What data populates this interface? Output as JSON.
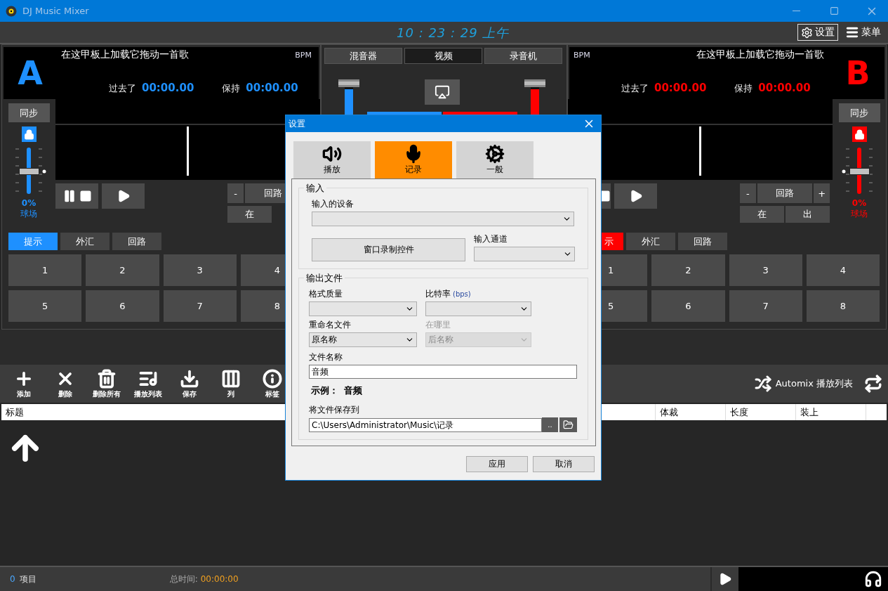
{
  "window": {
    "title": "DJ Music Mixer"
  },
  "clock": "10 : 23 : 29 上午",
  "top_buttons": [
    {
      "kind": "settings",
      "label": "设置"
    },
    {
      "kind": "menu",
      "label": "菜单"
    }
  ],
  "decks": [
    {
      "letter": "A",
      "color": "#1e90ff",
      "title": "在这甲板上加载它拖动一首歌",
      "bpm_label": "BPM",
      "elapsed_label": "过去了",
      "elapsed": "00:00.00",
      "remain_label": "保持",
      "remain": "00:00.00",
      "sync": "同步",
      "pitch": {
        "level": 0.5,
        "reading": "0%",
        "label": "球场"
      },
      "transport": [
        {
          "kind": "pause_stop"
        },
        {
          "kind": "play"
        }
      ],
      "loop_rows": [
        [
          {
            "kind": "small",
            "label": "-"
          },
          {
            "kind": "wide",
            "label": "回路"
          }
        ],
        [
          {
            "kind": "half",
            "label": "在"
          }
        ]
      ],
      "cue_tabs": [
        {
          "label": "提示",
          "selected": true
        },
        {
          "label": "外汇",
          "selected": false
        },
        {
          "label": "回路",
          "selected": false
        }
      ],
      "pads": [
        "1",
        "2",
        "3",
        "4",
        "5",
        "6",
        "7",
        "8"
      ]
    },
    {
      "letter": "B",
      "color": "#ff0000",
      "title": "在这甲板上加载它拖动一首歌",
      "bpm_label": "BPM",
      "elapsed_label": "过去了",
      "elapsed": "00:00.00",
      "remain_label": "保持",
      "remain": "00:00.00",
      "sync": "同步",
      "pitch": {
        "level": 0.5,
        "reading": "0%",
        "label": "球场"
      },
      "transport": [
        {
          "kind": "pause_stop"
        },
        {
          "kind": "play"
        }
      ],
      "loop_rows": [
        [
          {
            "kind": "small",
            "label": "-"
          },
          {
            "kind": "wide",
            "label": "回路"
          },
          {
            "kind": "small",
            "label": "+"
          }
        ],
        [
          {
            "kind": "half",
            "label": "在"
          },
          {
            "kind": "half",
            "label": "出"
          }
        ]
      ],
      "cue_tabs": [
        {
          "label": "示",
          "selected": true
        },
        {
          "label": "外汇",
          "selected": false
        },
        {
          "label": "回路",
          "selected": false
        }
      ],
      "pads": [
        "1",
        "2",
        "3",
        "4",
        "5",
        "6",
        "7",
        "8"
      ]
    }
  ],
  "mixer": {
    "tabs": [
      {
        "label": "混音器",
        "selected": false
      },
      {
        "label": "视频",
        "selected": true
      },
      {
        "label": "录音机",
        "selected": false
      }
    ],
    "faders": [
      {
        "level": 1,
        "color": "#1e90ff"
      },
      {
        "level": 1,
        "color": "#ff0000"
      }
    ]
  },
  "toolbar": [
    {
      "kind": "add",
      "label": "添加"
    },
    {
      "kind": "remove",
      "label": "删除"
    },
    {
      "kind": "clear",
      "label": "删除所有"
    },
    {
      "kind": "playlist",
      "label": "播放列表"
    },
    {
      "kind": "save",
      "label": "保存"
    },
    {
      "kind": "columns",
      "label": "列"
    },
    {
      "kind": "tags",
      "label": "标签"
    }
  ],
  "automix": {
    "label": "Automix 播放列表"
  },
  "table": {
    "columns": [
      "标题",
      "体裁",
      "长度",
      "装上"
    ]
  },
  "status_bar": {
    "count": "0",
    "count_label": "项目",
    "total_label": "总时间:",
    "total": "00:00:00"
  },
  "dialog": {
    "title": "设置",
    "tabs": [
      {
        "kind": "playback",
        "label": "播放",
        "selected": false
      },
      {
        "kind": "record",
        "label": "记录",
        "selected": true
      },
      {
        "kind": "general",
        "label": "一般",
        "selected": false
      }
    ],
    "input_group": {
      "title": "输入",
      "device_label": "输入的设备",
      "control_button": "窗口录制控件",
      "channel_label": "输入通道"
    },
    "output_group": {
      "title": "输出文件",
      "format_label": "格式质量",
      "bitrate_label": "比特率",
      "bitrate_unit": "(bps)",
      "rename_label": "重命名文件",
      "rename_value": "原名称",
      "where_label": "在哪里",
      "where_value": "后名称",
      "where_disabled": true,
      "filename_label": "文件名称",
      "filename_value": "音频",
      "example_label": "示例：",
      "example_value": "音频",
      "save_label": "将文件保存到",
      "save_path": "C:\\Users\\Administrator\\Music\\记录",
      "browse_button": ".."
    },
    "buttons": [
      "应用",
      "取消"
    ]
  }
}
